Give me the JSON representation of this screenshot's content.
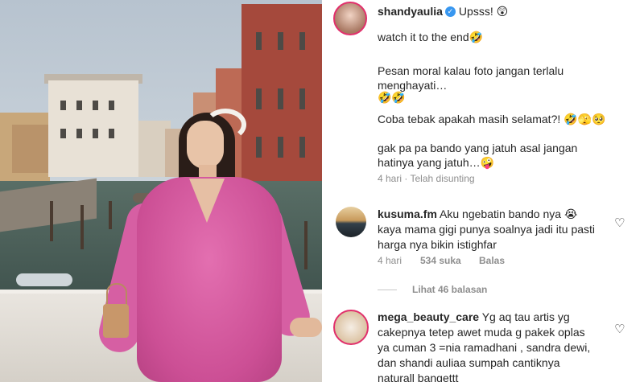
{
  "post": {
    "username": "shandyaulia",
    "verified_icon": "verified-badge-icon",
    "caption_lines": [
      "Upsss! 😲",
      "watch it to the end🤣",
      "Pesan moral kalau foto jangan terlalu",
      "menghayati…",
      "🤣🤣",
      "Coba tebak apakah masih selamat?! 🤣🫣🥺",
      "gak pa pa bando yang jatuh asal jangan",
      "hatinya yang jatuh…🤪"
    ],
    "time": "4 hari",
    "separator": "·",
    "edited": "Telah disunting"
  },
  "comments": [
    {
      "username": "kusuma.fm",
      "lines": [
        "Aku ngebatin bando nya 😭",
        "kaya mama gigi punya soalnya jadi itu pasti",
        "harga nya bikin istighfar"
      ],
      "time": "4 hari",
      "likes": "534 suka",
      "reply": "Balas",
      "view_replies": "Lihat 46 balasan"
    },
    {
      "username": "mega_beauty_care",
      "lines": [
        "Yg aq tau artis yg",
        "cakepnya tetep awet muda g pakek oplas",
        "ya cuman 3 =nia ramadhani , sandra dewi,",
        "dan shandi auliaa sumpah cantiknya",
        "naturall bangettt"
      ]
    }
  ],
  "icons": {
    "like": "heart-outline-icon"
  },
  "colors": {
    "meta_text": "#8e8e8e",
    "story_ring": "#e1306c",
    "verified": "#3897f0"
  }
}
